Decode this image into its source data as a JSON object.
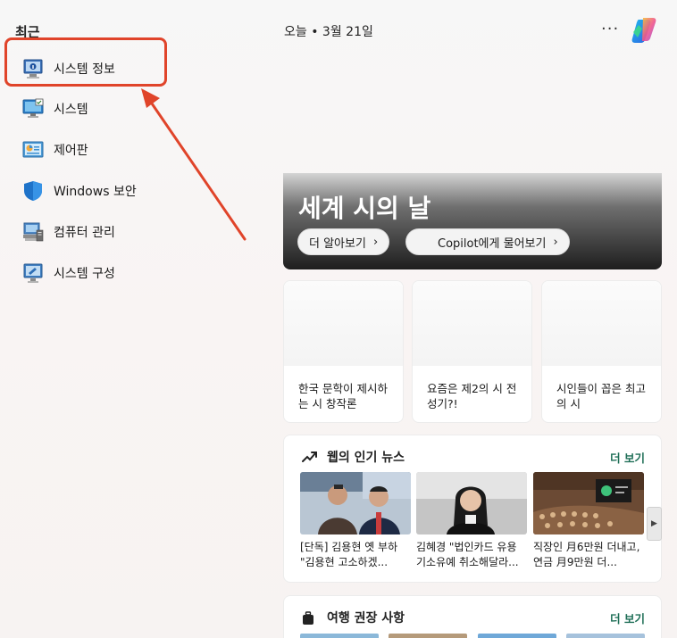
{
  "recent": {
    "title": "최근",
    "items": [
      {
        "label": "시스템 정보",
        "icon": "system-info-icon"
      },
      {
        "label": "시스템",
        "icon": "system-monitor-icon"
      },
      {
        "label": "제어판",
        "icon": "control-panel-icon"
      },
      {
        "label": "Windows 보안",
        "icon": "shield-icon"
      },
      {
        "label": "컴퓨터 관리",
        "icon": "computer-management-icon"
      },
      {
        "label": "시스템 구성",
        "icon": "system-config-icon"
      }
    ]
  },
  "feed": {
    "date_text": "오늘  •  3월 21일",
    "more": "···",
    "hero": {
      "title": "세계 시의 날",
      "learn_more": "더 알아보기",
      "ask_copilot": "Copilot에게 물어보기"
    },
    "cards": [
      {
        "text": "한국 문학이 제시하는 시 창작론"
      },
      {
        "text": "요즘은 제2의 시 전성기?!"
      },
      {
        "text": "시인들이 꼽은 최고의 시"
      }
    ],
    "news": {
      "title": "웹의 인기 뉴스",
      "more": "더 보기",
      "items": [
        {
          "caption": "[단독] 김용현 옛 부하 \"김용현 고소하겠..."
        },
        {
          "caption": "김혜경 \"법인카드 유용 기소유예 취소해달라..."
        },
        {
          "caption": "직장인 月6만원 더내고, 연금 月9만원 더..."
        }
      ],
      "scroll": "▶"
    },
    "travel": {
      "title": "여행 권장 사항",
      "more": "더 보기"
    }
  },
  "colors": {
    "highlight": "#e0442a",
    "accent_green": "#1f6f57"
  }
}
